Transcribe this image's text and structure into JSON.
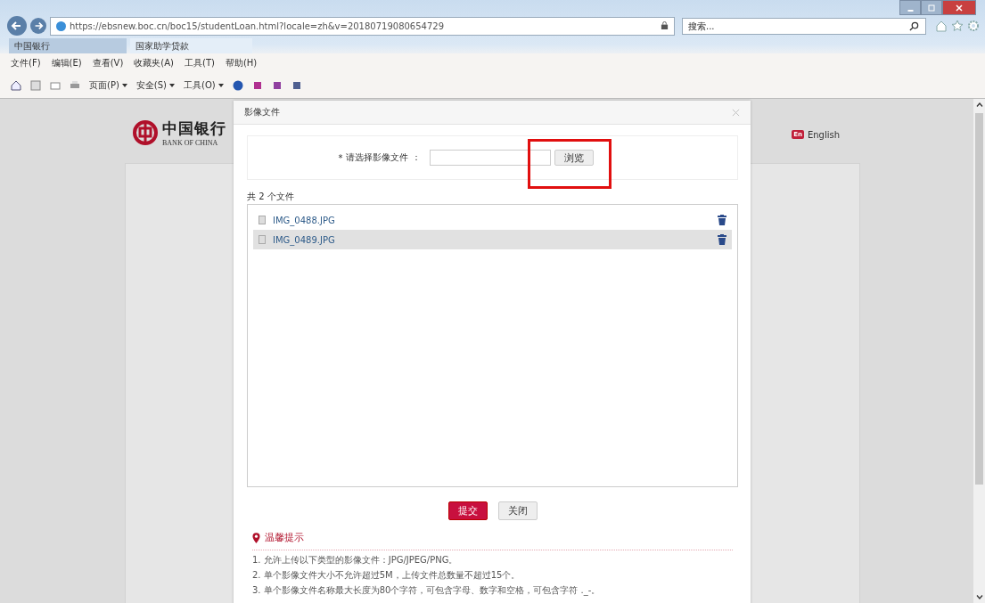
{
  "browser": {
    "address": "https://ebsnew.boc.cn/boc15/studentLoan.html?locale=zh&v=20180719080654729",
    "search": {
      "placeholder": "搜索..."
    },
    "tabs": [
      {
        "label": "中国银行",
        "selected": false
      },
      {
        "label": "国家助学贷款",
        "selected": true
      }
    ],
    "menu": [
      "文件(F)",
      "编辑(E)",
      "查看(V)",
      "收藏夹(A)",
      "工具(T)",
      "帮助(H)"
    ],
    "toolbar": [
      "页面(P)",
      "安全(S)",
      "工具(O)"
    ]
  },
  "page": {
    "logo": {
      "name": "中国银行",
      "subtitle": "BANK OF CHINA"
    },
    "language": {
      "badge": "En",
      "label": "English"
    }
  },
  "dialog": {
    "title": "影像文件",
    "required_mark": "*",
    "field_label": "请选择影像文件 ：",
    "browse_button": "浏览",
    "file_count": "共 2 个文件",
    "files": [
      {
        "name": "IMG_0488.JPG",
        "selected": false
      },
      {
        "name": "IMG_0489.JPG",
        "selected": true
      }
    ],
    "buttons": [
      {
        "label": "提交",
        "kind": "primary"
      },
      {
        "label": "关闭",
        "kind": "secondary"
      }
    ],
    "tips": {
      "title": "温馨提示",
      "items": [
        "1. 允许上传以下类型的影像文件：JPG/JPEG/PNG。",
        "2. 单个影像文件大小不允许超过5M，上传文件总数量不超过15个。",
        "3. 单个影像文件名称最大长度为80个字符，可包含字母、数字和空格，可包含字符 ._-。"
      ]
    }
  }
}
